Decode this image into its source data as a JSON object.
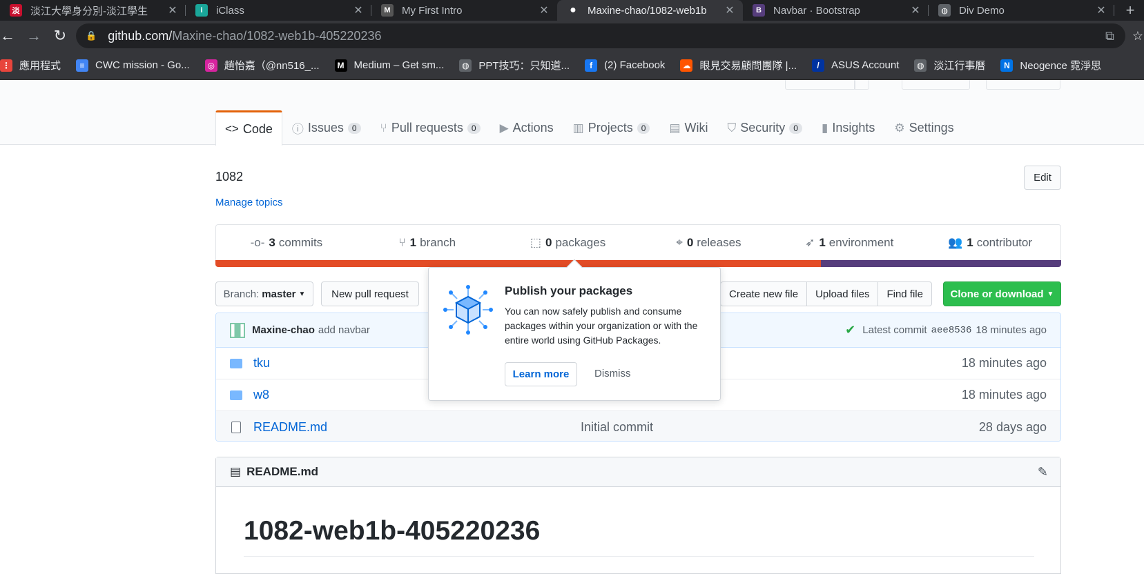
{
  "browser": {
    "tabs": [
      {
        "title": "淡江大學身分別-淡江學生",
        "icon": "tku-icon",
        "color": "#c8102e",
        "glyph": "淡"
      },
      {
        "title": "iClass",
        "icon": "iclass-icon",
        "color": "#1aa79a",
        "glyph": "i"
      },
      {
        "title": "My First Intro",
        "icon": "montana-icon",
        "color": "#555555",
        "glyph": "M"
      },
      {
        "title": "Maxine-chao/1082-web1b",
        "icon": "github-icon",
        "color": "#ffffff",
        "glyph": "●"
      },
      {
        "title": "Navbar · Bootstrap",
        "icon": "bootstrap-icon",
        "color": "#563d7c",
        "glyph": "B"
      },
      {
        "title": "Div Demo",
        "icon": "globe-icon",
        "color": "#5f6368",
        "glyph": "◍"
      }
    ],
    "url_host": "github.com/",
    "url_path": "Maxine-chao/1082-web1b-405220236",
    "bookmarks": [
      {
        "label": "應用程式",
        "color": "#e8453c",
        "glyph": "⋮"
      },
      {
        "label": "CWC mission - Go...",
        "color": "#4285f4",
        "glyph": "≡"
      },
      {
        "label": "趙怡嘉（@nn516_...",
        "color": "#d6249f",
        "glyph": "◎"
      },
      {
        "label": "Medium – Get sm...",
        "color": "#000000",
        "glyph": "M"
      },
      {
        "label": "PPT技巧：只知道...",
        "color": "#5f6368",
        "glyph": "◍"
      },
      {
        "label": "(2) Facebook",
        "color": "#1877f2",
        "glyph": "f"
      },
      {
        "label": "眼見交易顧問團隊 |...",
        "color": "#ff5500",
        "glyph": "☁"
      },
      {
        "label": "ASUS Account",
        "color": "#0033a0",
        "glyph": "/"
      },
      {
        "label": "淡江行事曆",
        "color": "#5f6368",
        "glyph": "◍"
      },
      {
        "label": "Neogence 霓淨思",
        "color": "#0073e6",
        "glyph": "N"
      }
    ]
  },
  "repo_nav": {
    "tabs": [
      {
        "label": "Code",
        "icon": "code-icon",
        "glyph": "<>",
        "count": null,
        "selected": true
      },
      {
        "label": "Issues",
        "icon": "issue-icon",
        "glyph": "ⓘ",
        "count": "0"
      },
      {
        "label": "Pull requests",
        "icon": "pull-request-icon",
        "glyph": "⑂",
        "count": "0"
      },
      {
        "label": "Actions",
        "icon": "play-icon",
        "glyph": "▶",
        "count": null
      },
      {
        "label": "Projects",
        "icon": "project-icon",
        "glyph": "▥",
        "count": "0"
      },
      {
        "label": "Wiki",
        "icon": "book-icon",
        "glyph": "▤",
        "count": null
      },
      {
        "label": "Security",
        "icon": "shield-icon",
        "glyph": "⛉",
        "count": "0"
      },
      {
        "label": "Insights",
        "icon": "graph-icon",
        "glyph": "▮",
        "count": null
      },
      {
        "label": "Settings",
        "icon": "gear-icon",
        "glyph": "⚙",
        "count": null
      }
    ]
  },
  "description": "1082",
  "manage_topics": "Manage topics",
  "edit_label": "Edit",
  "summary": [
    {
      "count": "3",
      "label": "commits",
      "icon": "commit-icon",
      "glyph": "-o-"
    },
    {
      "count": "1",
      "label": "branch",
      "icon": "branch-icon",
      "glyph": "⑂"
    },
    {
      "count": "0",
      "label": "packages",
      "icon": "package-icon",
      "glyph": "⬚"
    },
    {
      "count": "0",
      "label": "releases",
      "icon": "tag-icon",
      "glyph": "⌖"
    },
    {
      "count": "1",
      "label": "environment",
      "icon": "rocket-icon",
      "glyph": "➶"
    },
    {
      "count": "1",
      "label": "contributor",
      "icon": "people-icon",
      "glyph": "👥"
    }
  ],
  "languages": [
    {
      "color": "#e34c26",
      "fraction": 0.716
    },
    {
      "color": "#563d7c",
      "fraction": 0.284
    }
  ],
  "file_nav": {
    "branch_prefix": "Branch:",
    "branch": "master",
    "new_pr": "New pull request",
    "create_file": "Create new file",
    "upload": "Upload files",
    "find": "Find file",
    "clone": "Clone or download"
  },
  "latest_commit": {
    "author": "Maxine-chao",
    "message": "add navbar",
    "prefix": "Latest commit",
    "sha": "aee8536",
    "age": "18 minutes ago"
  },
  "files": [
    {
      "name": "tku",
      "type": "folder",
      "message": "",
      "age": "18 minutes ago"
    },
    {
      "name": "w8",
      "type": "folder",
      "message": "",
      "age": "18 minutes ago"
    },
    {
      "name": "README.md",
      "type": "file",
      "message": "Initial commit",
      "age": "28 days ago"
    }
  ],
  "readme": {
    "header": "README.md",
    "title": "1082-web1b-405220236"
  },
  "popover": {
    "title": "Publish your packages",
    "body": "You can now safely publish and consume packages within your organization or with the entire world using GitHub Packages.",
    "learn": "Learn more",
    "dismiss": "Dismiss"
  }
}
